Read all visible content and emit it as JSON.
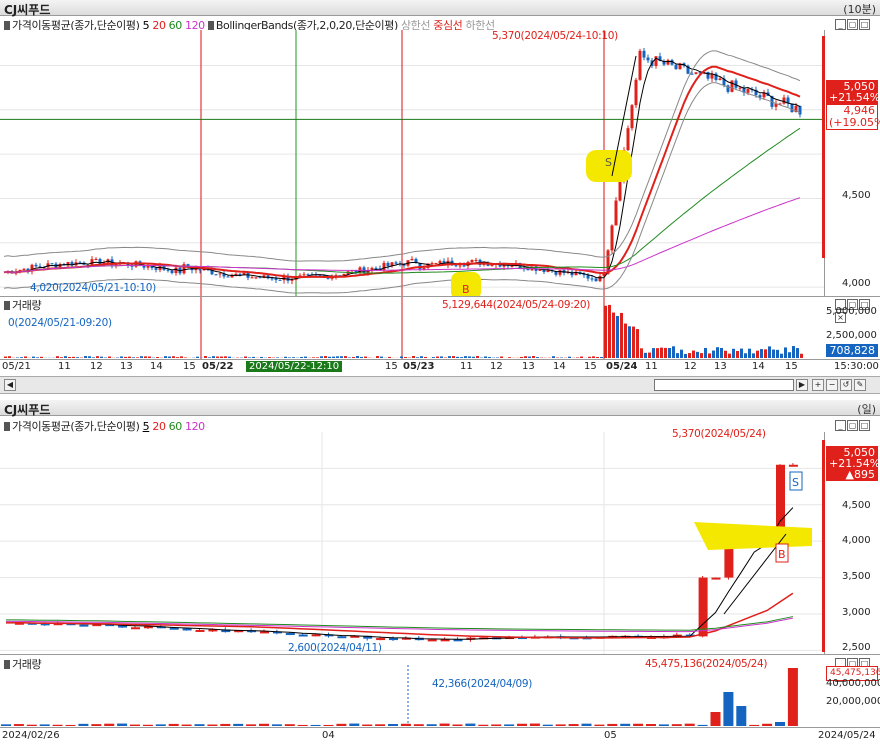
{
  "top": {
    "title": "CJ씨푸드",
    "period": "(10분)",
    "legend_ma": "가격이동평균(종가,단순이평)",
    "ma_periods": [
      "5",
      "20",
      "60",
      "120"
    ],
    "legend_bb": "BollingerBands(종가,2,0,20,단순이평)",
    "bb_upper": "상한선",
    "bb_mid": "중심선",
    "bb_lower": "하한선",
    "high_ann": "5,370(2024/05/24-10:10)",
    "low_ann": "4,020(2024/05/21-10:10)",
    "price_tag": "5,050",
    "price_change": "+21.54%",
    "cross_price": "4,946",
    "cross_change": "(+19.05%)",
    "y_ticks": [
      "4,500",
      "4,000"
    ],
    "buy_marker": "B",
    "sell_marker": "S",
    "volume_label": "거래량",
    "vol_low_ann": "0(2024/05/21-09:20)",
    "vol_high_ann": "5,129,644(2024/05/24-09:20)",
    "vol_ticks": [
      "5,000,000",
      "2,500,000"
    ],
    "vol_tag": "708,828",
    "x_ticks": [
      "05/21",
      "11",
      "12",
      "13",
      "14",
      "15",
      "05/22",
      "2024/05/22-12:10",
      "15",
      "05/23",
      "11",
      "12",
      "13",
      "14",
      "15",
      "05/24",
      "11",
      "12",
      "13",
      "14",
      "15"
    ],
    "x_end": "15:30:00",
    "colors": {
      "up": "#e0201a",
      "down": "#1565c0",
      "ma5": "#000000",
      "ma20": "#e0201a",
      "ma60": "#1f8a1f",
      "ma120": "#cc33cc",
      "bb": "#888888"
    }
  },
  "bottom": {
    "title": "CJ씨푸드",
    "period": "(일)",
    "legend_ma": "가격이동평균(종가,단순이평)",
    "ma_periods": [
      "5",
      "20",
      "60",
      "120"
    ],
    "high_ann": "5,370(2024/05/24)",
    "low_ann": "2,600(2024/04/11)",
    "price_tag": "5,050",
    "price_change": "+21.54%",
    "price_delta": "▲895",
    "y_ticks": [
      "4,500",
      "4,000",
      "3,500",
      "3,000",
      "2,500"
    ],
    "buy_marker": "B",
    "sell_marker": "S",
    "volume_label": "거래량",
    "vol_low_ann": "42,366(2024/04/09)",
    "vol_high_ann": "45,475,136(2024/05/24)",
    "vol_ticks": [
      "40,000,000",
      "20,000,000"
    ],
    "vol_tag": "45,475,136",
    "x_ticks": [
      "2024/02/26",
      "04",
      "05",
      "2024/05/24"
    ]
  },
  "chart_data": [
    {
      "type": "candlestick",
      "title": "CJ씨푸드 (10분)",
      "series": [
        {
          "name": "MA5"
        },
        {
          "name": "MA20"
        },
        {
          "name": "MA60"
        },
        {
          "name": "MA120"
        },
        {
          "name": "상한선"
        },
        {
          "name": "중심선"
        },
        {
          "name": "하한선"
        }
      ],
      "price_high": 5370,
      "price_low": 4020,
      "last_price": 5050,
      "ylim": [
        3950,
        5450
      ],
      "volume_max": 5129644,
      "volume_last": 708828
    },
    {
      "type": "candlestick",
      "title": "CJ씨푸드 (일)",
      "x_range": [
        "2024/02/26",
        "2024/05/24"
      ],
      "ylim": [
        2450,
        5500
      ],
      "price_high": 5370,
      "price_low": 2600,
      "last_price": 5050,
      "last_change": 895,
      "last_change_pct": 21.54,
      "volume_max": 45475136,
      "volume_min": 42366
    }
  ]
}
